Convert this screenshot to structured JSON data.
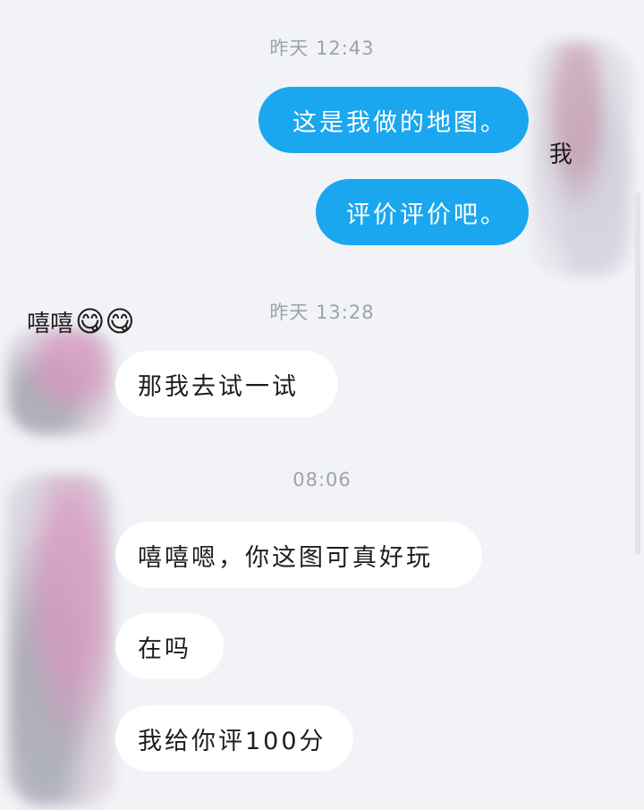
{
  "chat": {
    "self_name": "我",
    "friend_name": "嘻嘻",
    "friend_name_emoji": "😋😋",
    "timestamps": [
      "昨天 12:43",
      "昨天 13:28",
      "08:06"
    ],
    "outgoing": [
      {
        "text": "这是我做的地图。"
      },
      {
        "text": "评价评价吧。"
      }
    ],
    "incoming_group_1": [
      {
        "text": "那我去试一试"
      }
    ],
    "incoming_group_2": [
      {
        "text": "嘻嘻嗯，你这图可真好玩"
      },
      {
        "text": "在吗"
      },
      {
        "text": "我给你评100分"
      }
    ]
  },
  "colors": {
    "background": "#f1f3f6",
    "outgoing_bubble": "#1aa7ef",
    "incoming_bubble": "#ffffff",
    "timestamp_text": "#9ea3aa"
  }
}
